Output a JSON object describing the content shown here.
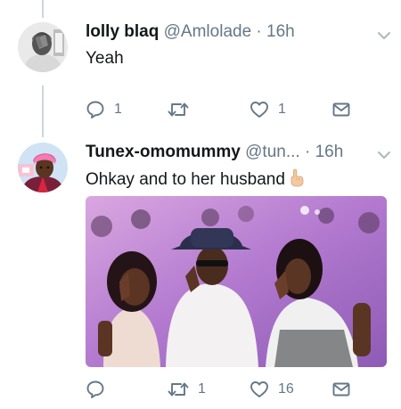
{
  "tweets": [
    {
      "display_name": "lolly blaq",
      "handle": "@Amlolade",
      "separator": "·",
      "time": "16h",
      "text": "Yeah",
      "actions": {
        "reply": "1",
        "retweet": "",
        "like": "1"
      },
      "avatar_icon": "user-avatar-hand-over-face"
    },
    {
      "display_name": "Tunex-omomummy",
      "handle": "@tun...",
      "separator": "·",
      "time": "16h",
      "text": "Ohkay and to her husband",
      "emoji": "pointing-hand-emoji",
      "media_icon": "party-photo",
      "actions": {
        "reply": "",
        "retweet": "1",
        "like": "16"
      },
      "avatar_icon": "user-avatar-pink-headwrap"
    }
  ],
  "colors": {
    "text": "#14171a",
    "muted": "#657786",
    "thread_line": "#ccd6dd"
  }
}
